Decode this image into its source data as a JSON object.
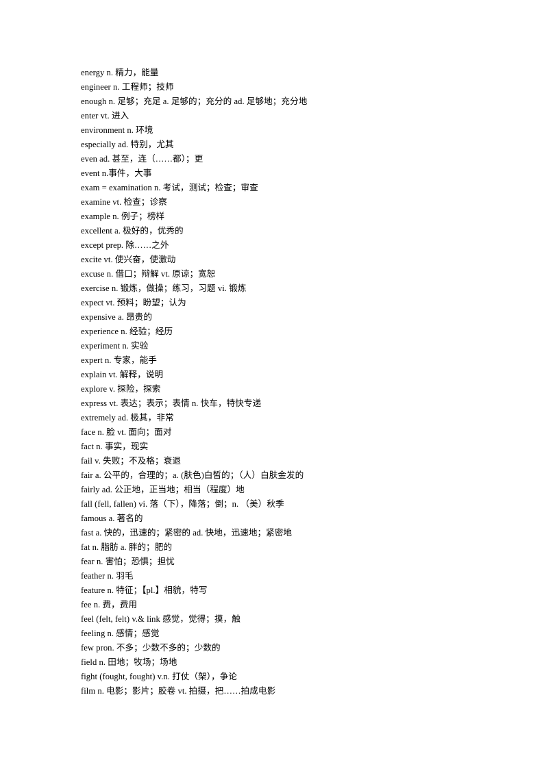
{
  "document": {
    "type": "vocabulary-list",
    "language_pair": "English-Chinese",
    "text_color": "#000000",
    "background_color": "#ffffff",
    "entries": [
      "energy n.  精力，能量",
      "engineer n.  工程师；技师",
      "enough n.  足够；充足  a.  足够的；充分的  ad.  足够地；充分地",
      "enter vt.  进入",
      "environment n.  环境",
      "especially ad.  特别，尤其",
      "even ad.  甚至，连（……都）；更",
      "event n.事件，大事",
      "exam = examination n.  考试，测试；检查；审查",
      "examine vt.  检查；诊察",
      "example n.  例子；榜样",
      "excellent a.  极好的，优秀的",
      "except prep.  除……之外",
      "excite vt.  使兴奋，使激动",
      "excuse n.  借口；辩解  vt.  原谅；宽恕",
      "exercise n.  锻炼，做操；练习，习题  vi.  锻炼",
      "expect vt.  预料；盼望；认为",
      "expensive a.  昂贵的",
      "experience n.  经验；经历",
      "experiment n.  实验",
      "expert n.  专家，能手",
      "explain vt.  解释，说明",
      "explore v.  探险，探索",
      "express vt.  表达；表示；表情  n.  快车，特快专递",
      "extremely ad.  极其，非常",
      "face n.  脸  vt.  面向；面对",
      "fact n.  事实，现实",
      "fail v.  失败；不及格；衰退",
      "fair a.  公平的，合理的；a. (肤色)白皙的；（人）白肤金发的",
      "fairly ad.  公正地，正当地；相当（程度）地",
      "fall (fell, fallen) vi.  落（下），降落；倒；n.  （美）秋季",
      "famous a.  著名的",
      "fast a.  快的，迅速的；紧密的  ad.  快地，迅速地；紧密地",
      "fat n.  脂肪  a.  胖的；肥的",
      "fear n.  害怕；恐惧；担忧",
      "feather n.  羽毛",
      "feature n.  特征；【pl.】相貌，特写",
      "fee n.  费，费用",
      "feel (felt, felt) v.& link  感觉，觉得；摸，触",
      "feeling n.  感情；感觉",
      "few pron.  不多；少数不多的；少数的",
      "field n.  田地；牧场；场地",
      "fight (fought, fought) v.n.  打仗（架），争论",
      "film n.  电影；影片；胶卷 vt.  拍摄，把……拍成电影"
    ]
  }
}
